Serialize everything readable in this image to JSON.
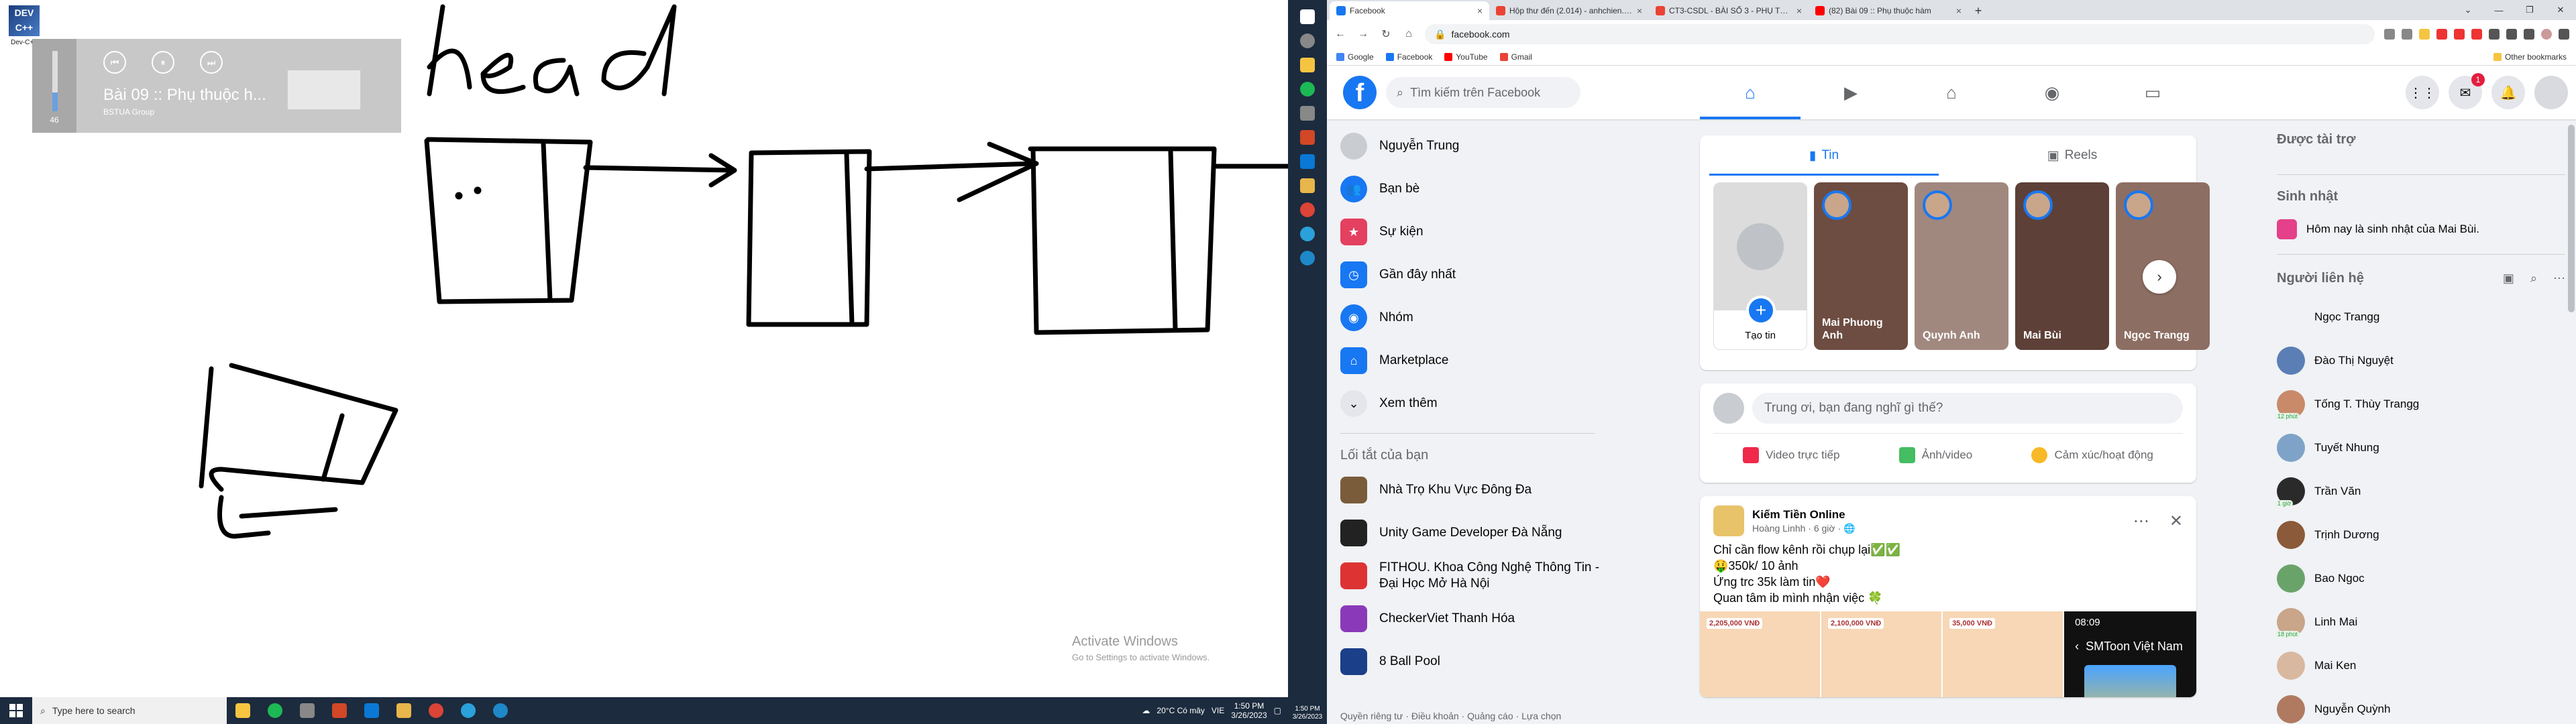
{
  "desktop": {
    "icon_text": "DEV C++",
    "icon_label": "Dev-C++",
    "media": {
      "title": "Bài 09 :: Phụ thuộc h...",
      "artist": "BSTUA Group",
      "volume": "46",
      "prev": "⏮",
      "play": "⏸",
      "next": "⏭"
    },
    "activate": {
      "title": "Activate Windows",
      "subtitle": "Go to Settings to activate Windows."
    }
  },
  "taskbar": {
    "search_placeholder": "Type here to search",
    "weather": "20°C Có mây",
    "lang": "VIE",
    "time": "1:50 PM",
    "date": "3/26/2023"
  },
  "vbar": {
    "time": "1:50 PM",
    "date": "3/26/2023"
  },
  "browser": {
    "tabs": [
      {
        "title": "Facebook",
        "color": "#1877f2"
      },
      {
        "title": "Hộp thư đến (2.014) - anhchien.c...",
        "color": "#ea4335"
      },
      {
        "title": "CT3-CSDL - BÀI SỐ 3 - PHỤ THU...",
        "color": "#ea4335"
      },
      {
        "title": "(82) Bài 09 :: Phụ thuộc hàm",
        "color": "#ff0000"
      }
    ],
    "url": "facebook.com",
    "bookmarks": [
      {
        "label": "Google",
        "color": "#4285f4"
      },
      {
        "label": "Facebook",
        "color": "#1877f2"
      },
      {
        "label": "YouTube",
        "color": "#ff0000"
      },
      {
        "label": "Gmail",
        "color": "#ea4335"
      }
    ],
    "other_bookmarks": "Other bookmarks"
  },
  "fb": {
    "search_placeholder": "Tìm kiếm trên Facebook",
    "messenger_badge": "1",
    "left_nav": [
      {
        "label": "Nguyễn Trung",
        "color": "#c9ccd1",
        "icon": "avatar"
      },
      {
        "label": "Bạn bè",
        "color": "#1877f2",
        "icon": "friends-icon"
      },
      {
        "label": "Sự kiện",
        "color": "#e4405f",
        "icon": "calendar-icon"
      },
      {
        "label": "Gần đây nhất",
        "color": "#1877f2",
        "icon": "clock-icon"
      },
      {
        "label": "Nhóm",
        "color": "#1877f2",
        "icon": "groups-icon"
      },
      {
        "label": "Marketplace",
        "color": "#1877f2",
        "icon": "shop-icon"
      },
      {
        "label": "Xem thêm",
        "color": "#e4e6eb",
        "icon": "chevron-down-icon"
      }
    ],
    "shortcuts_title": "Lối tắt của bạn",
    "shortcuts": [
      {
        "label": "Nhà Trọ Khu Vực Đông Đa",
        "color": "#7a5c3a"
      },
      {
        "label": "Unity Game Developer Đà Nẵng",
        "color": "#222"
      },
      {
        "label": "FITHOU. Khoa Công Nghệ Thông Tin - Đại Học Mở Hà Nội",
        "color": "#d33"
      },
      {
        "label": "CheckerViet Thanh Hóa",
        "color": "#8a3ab9"
      },
      {
        "label": "8 Ball Pool",
        "color": "#1c3f8a"
      }
    ],
    "footer": "Quyền riêng tư · Điều khoản · Quảng cáo · Lựa chọn",
    "story_tabs": {
      "tin": "Tin",
      "reels": "Reels"
    },
    "create_story": "Tạo tin",
    "stories": [
      {
        "name": "Mai Phuong Anh",
        "color": "#6d4c41"
      },
      {
        "name": "Quynh Anh",
        "color": "#a1887f"
      },
      {
        "name": "Mai Bùi",
        "color": "#5d4037"
      },
      {
        "name": "Ngọc Trangg",
        "color": "#8d6e63"
      }
    ],
    "composer": {
      "placeholder": "Trung ơi, bạn đang nghĩ gì thế?",
      "live": "Video trực tiếp",
      "photo": "Ảnh/video",
      "feeling": "Cảm xúc/hoạt động"
    },
    "post": {
      "page": "Kiếm Tiền Online",
      "author": "Hoàng Linhh · 6 giờ · 🌐",
      "lines": [
        "Chỉ cần flow kênh rồi chụp lại✅✅",
        "🤑350k/ 10 ảnh",
        "Ứng trc 35k làm tin❤️",
        "Quan tâm ib mình nhận việc 🍀"
      ],
      "prices": [
        "2,205,000 VNĐ",
        "2,100,000 VNĐ",
        "35,000 VNĐ"
      ],
      "overlay_time": "08:09",
      "overlay_channel": "SMToon Việt Nam"
    },
    "sponsored_title": "Được tài trợ",
    "birthday_title": "Sinh nhật",
    "birthday_text": "Hôm nay là sinh nhật của Mai Bùi.",
    "contacts_title": "Người liên hệ",
    "contacts": [
      {
        "name": "Ngọc Trangg",
        "color": "#f0f2f5",
        "online": false,
        "min": ""
      },
      {
        "name": "Đào Thị Nguyệt",
        "color": "#5b7fb5",
        "online": false,
        "min": ""
      },
      {
        "name": "Tống T. Thùy Trangg",
        "color": "#c98a6a",
        "online": false,
        "min": "12 phút"
      },
      {
        "name": "Tuyết Nhung",
        "color": "#7fa3c8",
        "online": false,
        "min": ""
      },
      {
        "name": "Trần Văn",
        "color": "#2a2a2a",
        "online": false,
        "min": "1 giờ"
      },
      {
        "name": "Trịnh Dương",
        "color": "#8a5a3a",
        "online": false,
        "min": ""
      },
      {
        "name": "Bao Ngoc",
        "color": "#6aa36a",
        "online": false,
        "min": ""
      },
      {
        "name": "Linh Mai",
        "color": "#c9a58a",
        "online": false,
        "min": "18 phút"
      },
      {
        "name": "Mai Ken",
        "color": "#d9b8a0",
        "online": false,
        "min": ""
      },
      {
        "name": "Nguyễn Quỳnh",
        "color": "#b07a60",
        "online": false,
        "min": ""
      }
    ]
  }
}
